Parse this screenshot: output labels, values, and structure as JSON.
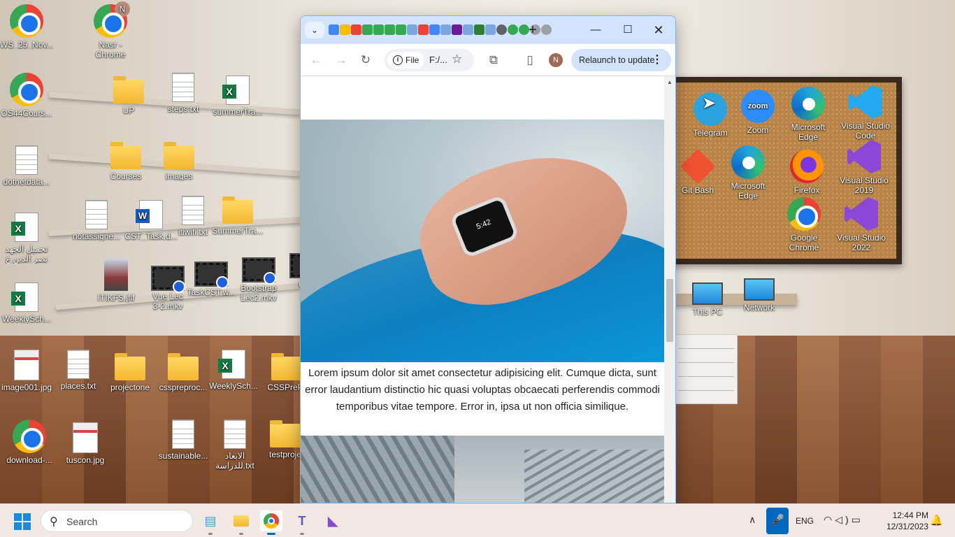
{
  "desktop": {
    "icons": [
      {
        "label": "WS_25_Nov...",
        "type": "chrome"
      },
      {
        "label": "Nasr -\nChrome",
        "type": "chrome",
        "badge": "N"
      },
      {
        "label": "OS44Cours...",
        "type": "chrome"
      },
      {
        "label": "UP",
        "type": "folder"
      },
      {
        "label": "steps.txt",
        "type": "txt"
      },
      {
        "label": "summerTra...",
        "type": "xls"
      },
      {
        "label": "dotnetdata...",
        "type": "txt"
      },
      {
        "label": "Courses",
        "type": "folder"
      },
      {
        "label": "images",
        "type": "folder"
      },
      {
        "label": "تحميل الجهد\nنصر الدين ع",
        "type": "xls"
      },
      {
        "label": "notassigne...",
        "type": "txt"
      },
      {
        "label": "CST_Task.d...",
        "type": "doc"
      },
      {
        "label": "itiwifi.txt",
        "type": "txt"
      },
      {
        "label": "SummerTra...",
        "type": "folder"
      },
      {
        "label": "ITIKFS.jfif",
        "type": "img"
      },
      {
        "label": "Vue Lec\n3-2.mkv",
        "type": "video"
      },
      {
        "label": "TaskCST.w...",
        "type": "video"
      },
      {
        "label": "Bootstrap\nLec2.mkv",
        "type": "video"
      },
      {
        "label": "univ",
        "type": "video"
      },
      {
        "label": "WeeklySch...",
        "type": "xls"
      },
      {
        "label": "image001.jpg",
        "type": "img2"
      },
      {
        "label": "places.txt",
        "type": "txt"
      },
      {
        "label": "projectone",
        "type": "folder"
      },
      {
        "label": "csspreproc...",
        "type": "folder"
      },
      {
        "label": "WeeklySch...",
        "type": "xls"
      },
      {
        "label": "CSSPrePr",
        "type": "folder"
      },
      {
        "label": "download-...",
        "type": "chrome"
      },
      {
        "label": "tuscon.jpg",
        "type": "img2"
      },
      {
        "label": "sustainable...",
        "type": "txt"
      },
      {
        "label": "الابعاد\nللدراسة.txt",
        "type": "txt"
      },
      {
        "label": "testproje",
        "type": "folder"
      },
      {
        "label": "Telegram",
        "type": "tg"
      },
      {
        "label": "Zoom",
        "type": "zoom"
      },
      {
        "label": "Microsoft\nEdge",
        "type": "edge"
      },
      {
        "label": "Visual Studio\nCode",
        "type": "vscode"
      },
      {
        "label": "Git Bash",
        "type": "git"
      },
      {
        "label": "Microsoft\nEdge",
        "type": "edge"
      },
      {
        "label": "Firefox",
        "type": "ff"
      },
      {
        "label": "Visual Studio\n2019",
        "type": "vs"
      },
      {
        "label": "Google\nChrome",
        "type": "chrome"
      },
      {
        "label": "Visual Studio\n2022",
        "type": "vs"
      },
      {
        "label": "This PC",
        "type": "pc"
      },
      {
        "label": "Network",
        "type": "net"
      }
    ],
    "zoom_text": "zoom"
  },
  "browser": {
    "new_tab": "+",
    "minimize": "—",
    "maximize": "☐",
    "close": "✕",
    "site_chip": "File",
    "url": "F:/...",
    "profile_initial": "N",
    "relaunch_label": "Relaunch to update",
    "scroll_position": 0.55,
    "watch_text": "5:42",
    "caption": "Lorem ipsum dolor sit amet consectetur adipisicing elit. Cumque dicta, sunt error laudantium distinctio hic quasi voluptas obcaecati perferendis commodi temporibus vitae tempore. Error in, ipsa ut non officia similique."
  },
  "taskbar": {
    "search_placeholder": "Search",
    "language": "ENG",
    "time": "12:44 PM",
    "date": "12/31/2023"
  }
}
